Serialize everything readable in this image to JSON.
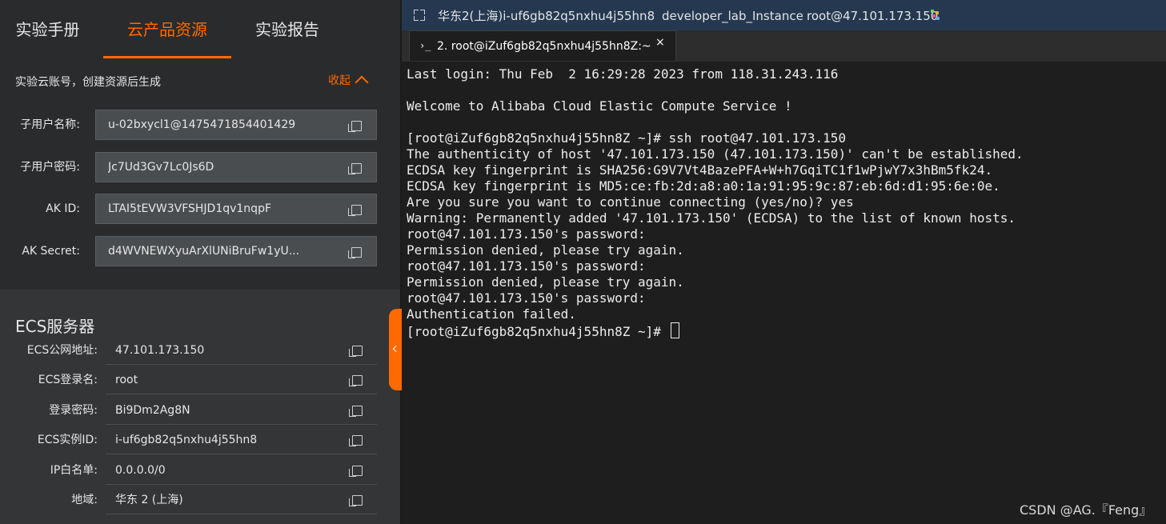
{
  "left_tabs": [
    "实验手册",
    "云产品资源",
    "实验报告"
  ],
  "account": {
    "title": "实验云账号，创建资源后生成",
    "collapse_label": "收起",
    "fields": [
      {
        "label": "子用户名称:",
        "value": "u-02bxycl1@1475471854401429"
      },
      {
        "label": "子用户密码:",
        "value": "Jc7Ud3Gv7Lc0Js6D"
      },
      {
        "label": "AK ID:",
        "value": "LTAI5tEVW3VFSHJD1qv1nqpF"
      },
      {
        "label": "AK Secret:",
        "value": "d4WVNEWXyuArXlUNiBruFw1yU..."
      }
    ]
  },
  "ecs": {
    "title": "ECS服务器",
    "fields": [
      {
        "label": "ECS公网地址:",
        "value": "47.101.173.150"
      },
      {
        "label": "ECS登录名:",
        "value": "root"
      },
      {
        "label": "登录密码:",
        "value": "Bi9Dm2Ag8N"
      },
      {
        "label": "ECS实例ID:",
        "value": "i-uf6gb82q5nxhu4j55hn8"
      },
      {
        "label": "IP白名单:",
        "value": "0.0.0.0/0"
      },
      {
        "label": "地域:",
        "value": "华东 2 (上海)"
      }
    ]
  },
  "topbar": {
    "region_instance": "华东2(上海)i-uf6gb82q5nxhu4j55hn8",
    "lab_instance": "developer_lab_Instance",
    "host": "root@47.101.173.150"
  },
  "terminal_tab": {
    "icon": "›_",
    "label": "2. root@iZuf6gb82q5nxhu4j55hn8Z:~",
    "close": "×"
  },
  "terminal_lines": [
    "Last login: Thu Feb  2 16:29:28 2023 from 118.31.243.116",
    "",
    "Welcome to Alibaba Cloud Elastic Compute Service !",
    "",
    "[root@iZuf6gb82q5nxhu4j55hn8Z ~]# ssh root@47.101.173.150",
    "The authenticity of host '47.101.173.150 (47.101.173.150)' can't be established.",
    "ECDSA key fingerprint is SHA256:G9V7Vt4BazePFA+W+h7GqiTC1f1wPjwY7x3hBm5fk24.",
    "ECDSA key fingerprint is MD5:ce:fb:2d:a8:a0:1a:91:95:9c:87:eb:6d:d1:95:6e:0e.",
    "Are you sure you want to continue connecting (yes/no)? yes",
    "Warning: Permanently added '47.101.173.150' (ECDSA) to the list of known hosts.",
    "root@47.101.173.150's password:",
    "Permission denied, please try again.",
    "root@47.101.173.150's password:",
    "Permission denied, please try again.",
    "root@47.101.173.150's password:",
    "Authentication failed."
  ],
  "prompt": "[root@iZuf6gb82q5nxhu4j55hn8Z ~]# ",
  "watermark": "CSDN @AG.『Feng』",
  "colors": {
    "accent": "#ff6a00",
    "topbar": "#26384f",
    "terminal_bg": "#1e1e1e",
    "panel_bg": "#333537"
  }
}
